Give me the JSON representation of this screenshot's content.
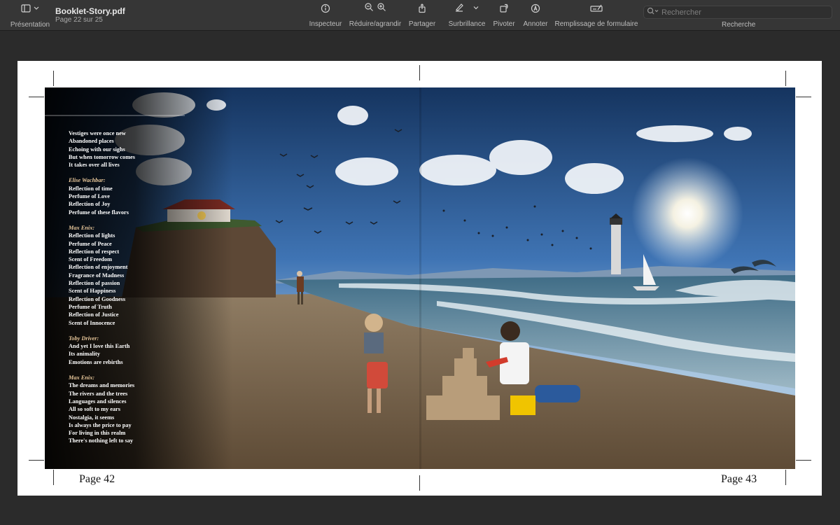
{
  "toolbar": {
    "view_label": "Présentation",
    "doc_title": "Booklet-Story.pdf",
    "doc_page": "Page 22 sur 25",
    "inspector": "Inspecteur",
    "zoom": "Réduire/agrandir",
    "share": "Partager",
    "highlight": "Surbrillance",
    "rotate": "Pivoter",
    "annotate": "Annoter",
    "form_fill": "Remplissage de formulaire",
    "search_placeholder": "Rechercher",
    "search_label": "Recherche"
  },
  "icons": {
    "sidebar": "sidebar-icon",
    "info": "info-icon",
    "zoom_out": "zoom-out-icon",
    "zoom_in": "zoom-in-icon",
    "share": "share-icon",
    "highlighter": "highlighter-icon",
    "rotate": "rotate-icon",
    "markup": "markup-icon",
    "form": "form-icon",
    "search": "search-icon"
  },
  "poem": {
    "stanza1": [
      "Vestiges were once new",
      "Abandoned places",
      "Echoing with our sighs",
      "But when tomorrow comes",
      "It takes over all lives"
    ],
    "author2": "Elise Wachbar:",
    "stanza2": [
      "Reflection of time",
      "Perfume of Love",
      "Reflection of Joy",
      "Perfume of these flavors"
    ],
    "author3": "Max Enix:",
    "stanza3": [
      "Reflection of lights",
      "Perfume of Peace",
      "Reflection of respect",
      "Scent of Freedom",
      "Reflection of enjoyment",
      "Fragrance of Madness",
      "Reflection of passion",
      "Scent of Happiness",
      "Reflection of Goodness",
      "Perfume of Truth",
      "Reflection of Justice",
      "Scent of Innocence"
    ],
    "author4": "Toby Driver:",
    "stanza4": [
      "And yet I love this Earth",
      "Its animality",
      "Emotions are rebirths"
    ],
    "author5": "Max Enix:",
    "stanza5": [
      "The dreams and memories",
      "The rivers and the trees",
      "Languages and silences",
      "All so soft to my ears",
      "Nostalgia, it seems",
      "Is always the price to pay",
      "For living in this realm",
      "There's nothing left to say"
    ]
  },
  "pages": {
    "left": "Page 42",
    "right": "Page 43"
  }
}
